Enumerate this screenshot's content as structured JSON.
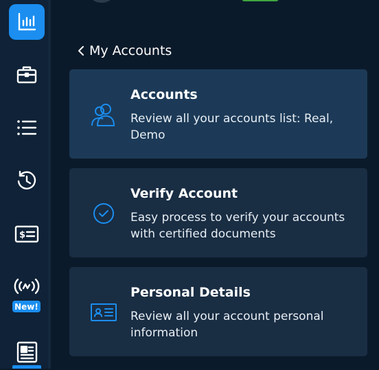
{
  "sidebar": {
    "items": [
      {
        "name": "analytics",
        "icon": "bar-chart-icon",
        "active": true
      },
      {
        "name": "portfolio",
        "icon": "briefcase-icon",
        "active": false
      },
      {
        "name": "orders",
        "icon": "list-icon",
        "active": false
      },
      {
        "name": "history",
        "icon": "history-icon",
        "active": false
      },
      {
        "name": "deposit",
        "icon": "cash-card-icon",
        "active": false
      },
      {
        "name": "signals",
        "icon": "broadcast-icon",
        "active": false,
        "badge": "New!"
      },
      {
        "name": "news",
        "icon": "newspaper-icon",
        "active": false
      }
    ]
  },
  "main": {
    "back_label": "My Accounts",
    "cards": [
      {
        "title": "Accounts",
        "description": "Review all your accounts list: Real, Demo",
        "icon": "users-icon"
      },
      {
        "title": "Verify Account",
        "description": "Easy process to verify your accounts with certified documents",
        "icon": "check-circle-icon"
      },
      {
        "title": "Personal Details",
        "description": "Review all your account personal information",
        "icon": "id-card-icon"
      }
    ]
  },
  "colors": {
    "accent": "#1b8ef0",
    "background": "#0b1a2a",
    "card": "#192d43",
    "card_selected": "#1c3a57",
    "sidebar": "#0f2237"
  }
}
